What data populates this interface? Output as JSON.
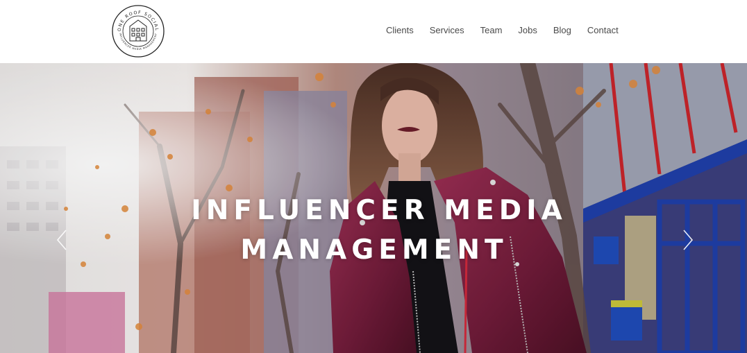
{
  "logo": {
    "top_text": "ONE ROOF SOCIAL",
    "bottom_text": "INFLUENCER MEDIA MANAGEMENT",
    "icon": "building-icon"
  },
  "nav": {
    "items": [
      {
        "label": "Clients"
      },
      {
        "label": "Services"
      },
      {
        "label": "Team"
      },
      {
        "label": "Jobs"
      },
      {
        "label": "Blog"
      },
      {
        "label": "Contact"
      }
    ]
  },
  "hero": {
    "headline_line1": "INFLUENCER MEDIA",
    "headline_line2": "MANAGEMENT",
    "prev_icon": "chevron-left-icon",
    "next_icon": "chevron-right-icon"
  },
  "colors": {
    "nav_text": "#4a4a4a",
    "headline": "#ffffff",
    "jacket": "#7a1f3d",
    "storefront_blue": "#1f3fa8",
    "storefront_red": "#c8242b"
  }
}
